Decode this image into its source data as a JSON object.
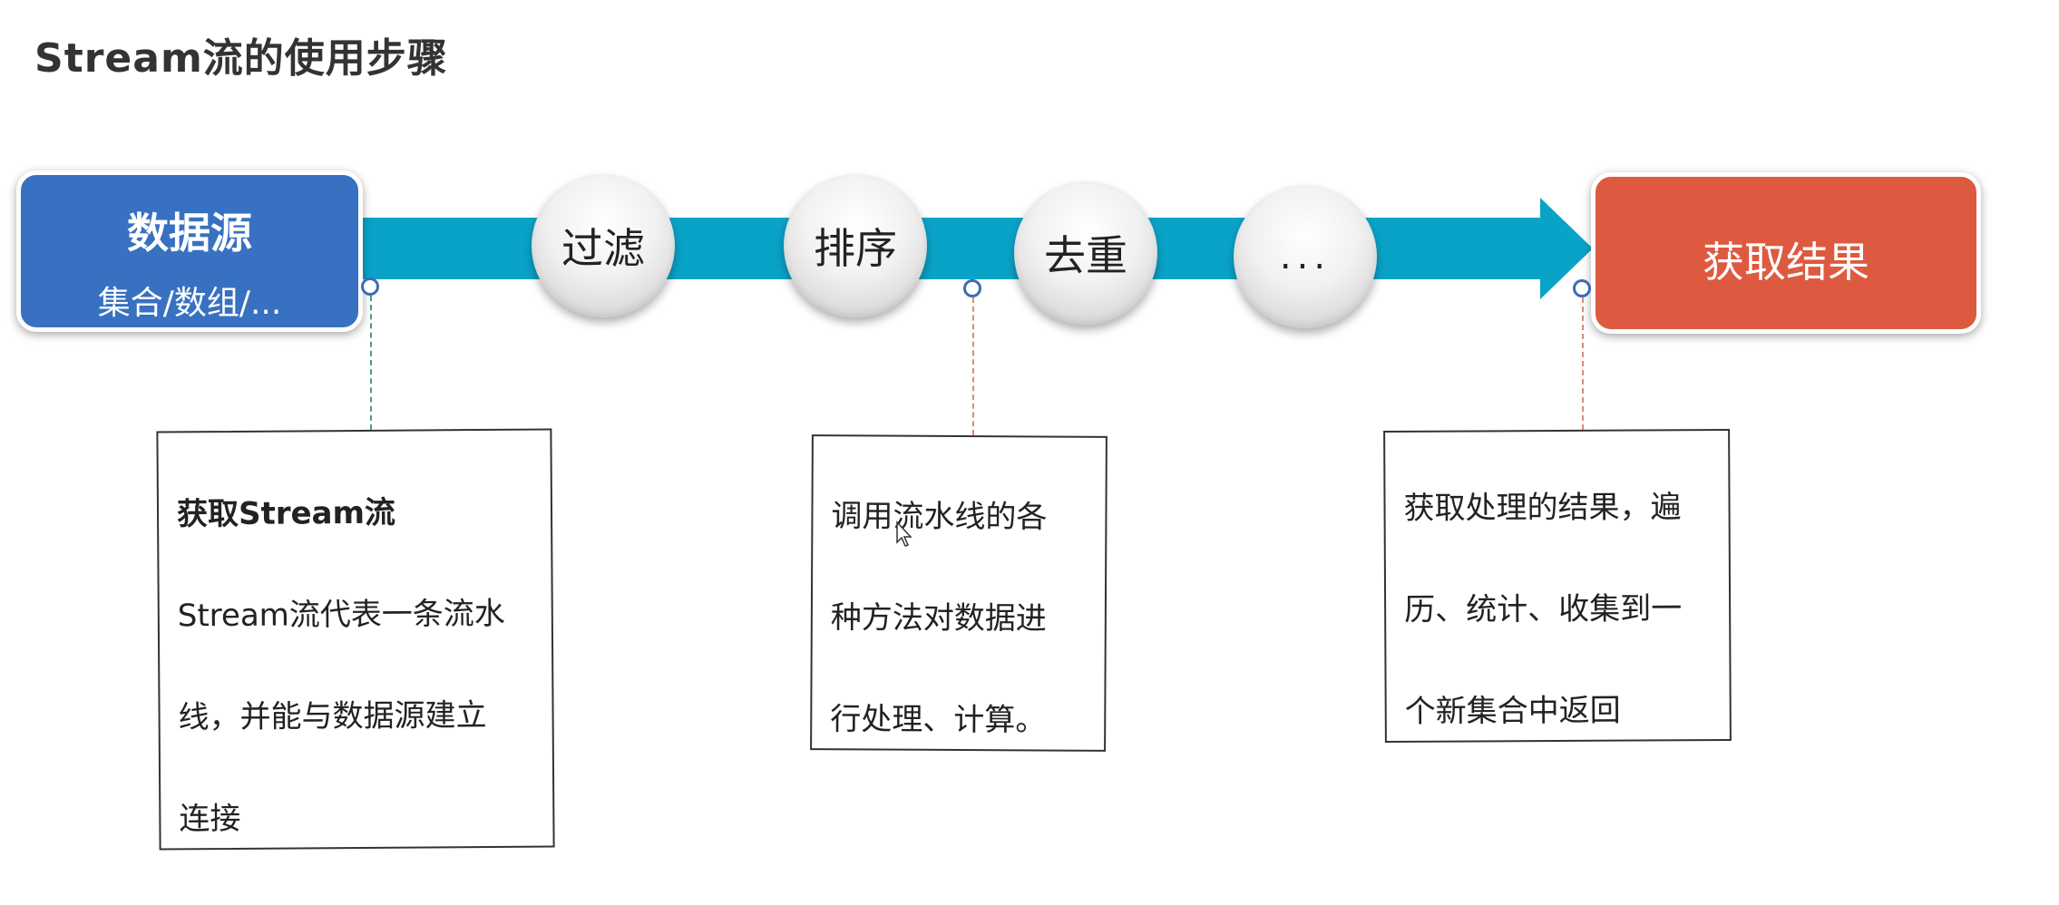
{
  "title": "Stream流的使用步骤",
  "source_box": {
    "label": "数据源",
    "sub": "集合/数组/..."
  },
  "steps": [
    "过滤",
    "排序",
    "去重",
    "..."
  ],
  "result_box": {
    "label": "获取结果"
  },
  "notes": [
    {
      "heading": "获取Stream流",
      "lines": [
        "Stream流代表一条流水",
        "线，并能与数据源建立",
        "连接"
      ]
    },
    {
      "lines": [
        "调用流水线的各",
        "种方法对数据进",
        "行处理、计算。"
      ]
    },
    {
      "lines": [
        "获取处理的结果，遍",
        "历、统计、收集到一",
        "个新集合中返回"
      ]
    }
  ],
  "colors": {
    "pipe": "#0aa3c8",
    "source": "#3871c1",
    "result": "#dd5a40"
  }
}
